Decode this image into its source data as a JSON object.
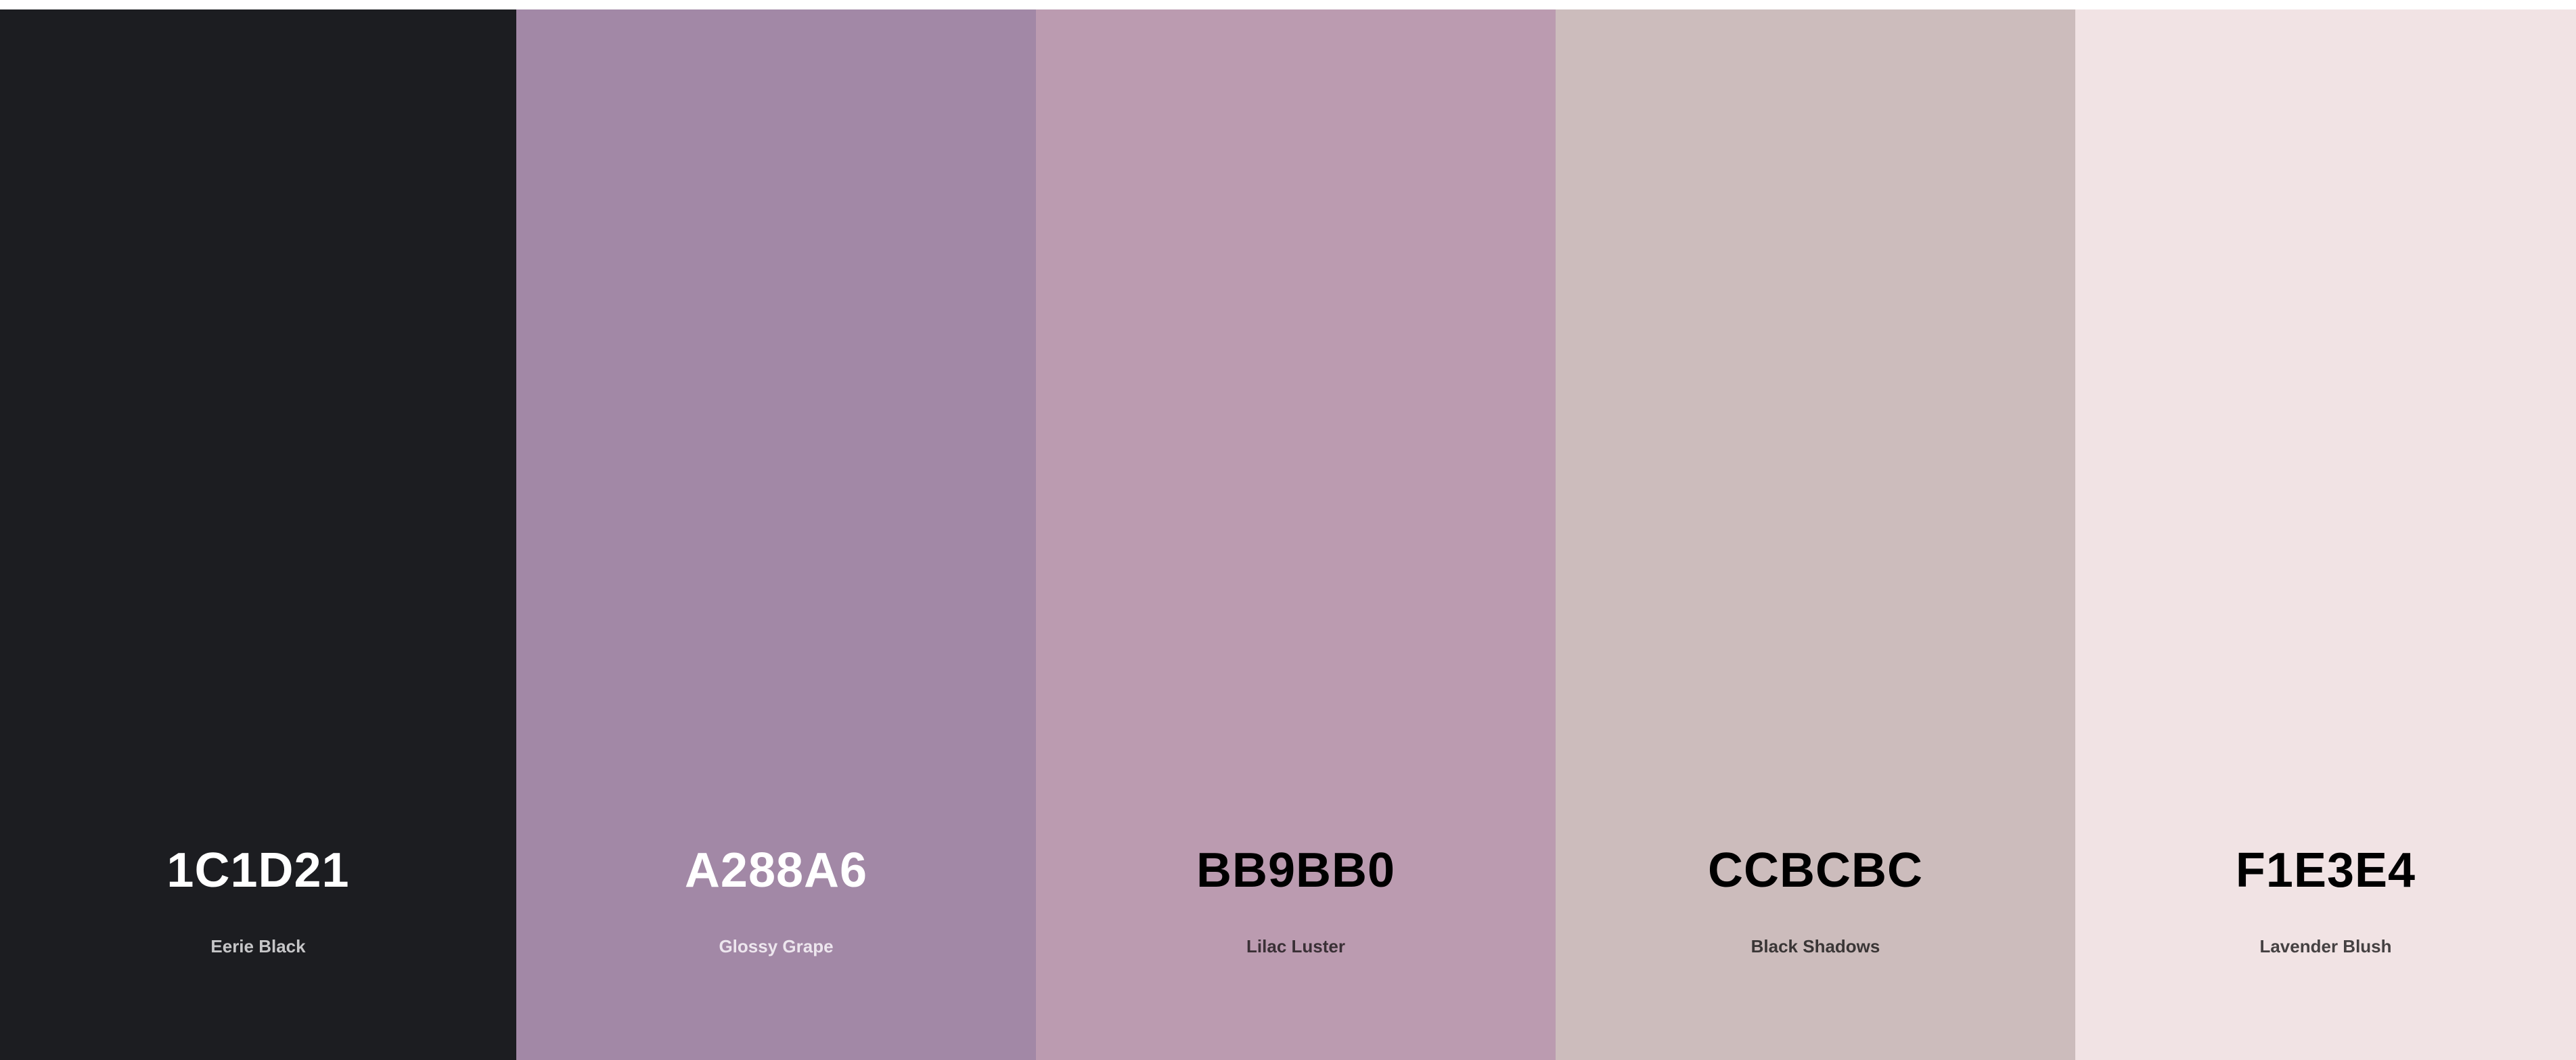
{
  "palette": {
    "colors": [
      {
        "hex": "1C1D21",
        "name": "Eerie Black",
        "swatch_color": "#1C1D21",
        "hex_text_color": "#FFFFFF",
        "name_text_color": "#C6C6C8"
      },
      {
        "hex": "A288A6",
        "name": "Glossy Grape",
        "swatch_color": "#A288A6",
        "hex_text_color": "#FFFFFF",
        "name_text_color": "#EDE6EE"
      },
      {
        "hex": "BB9BB0",
        "name": "Lilac Luster",
        "swatch_color": "#BB9BB0",
        "hex_text_color": "#000000",
        "name_text_color": "#3A3036"
      },
      {
        "hex": "CCBCBC",
        "name": "Black Shadows",
        "swatch_color": "#CCBCBC",
        "hex_text_color": "#000000",
        "name_text_color": "#3A3636"
      },
      {
        "hex": "F1E3E4",
        "name": "Lavender Blush",
        "swatch_color": "#F1E3E4",
        "hex_text_color": "#000000",
        "name_text_color": "#454142"
      }
    ]
  }
}
